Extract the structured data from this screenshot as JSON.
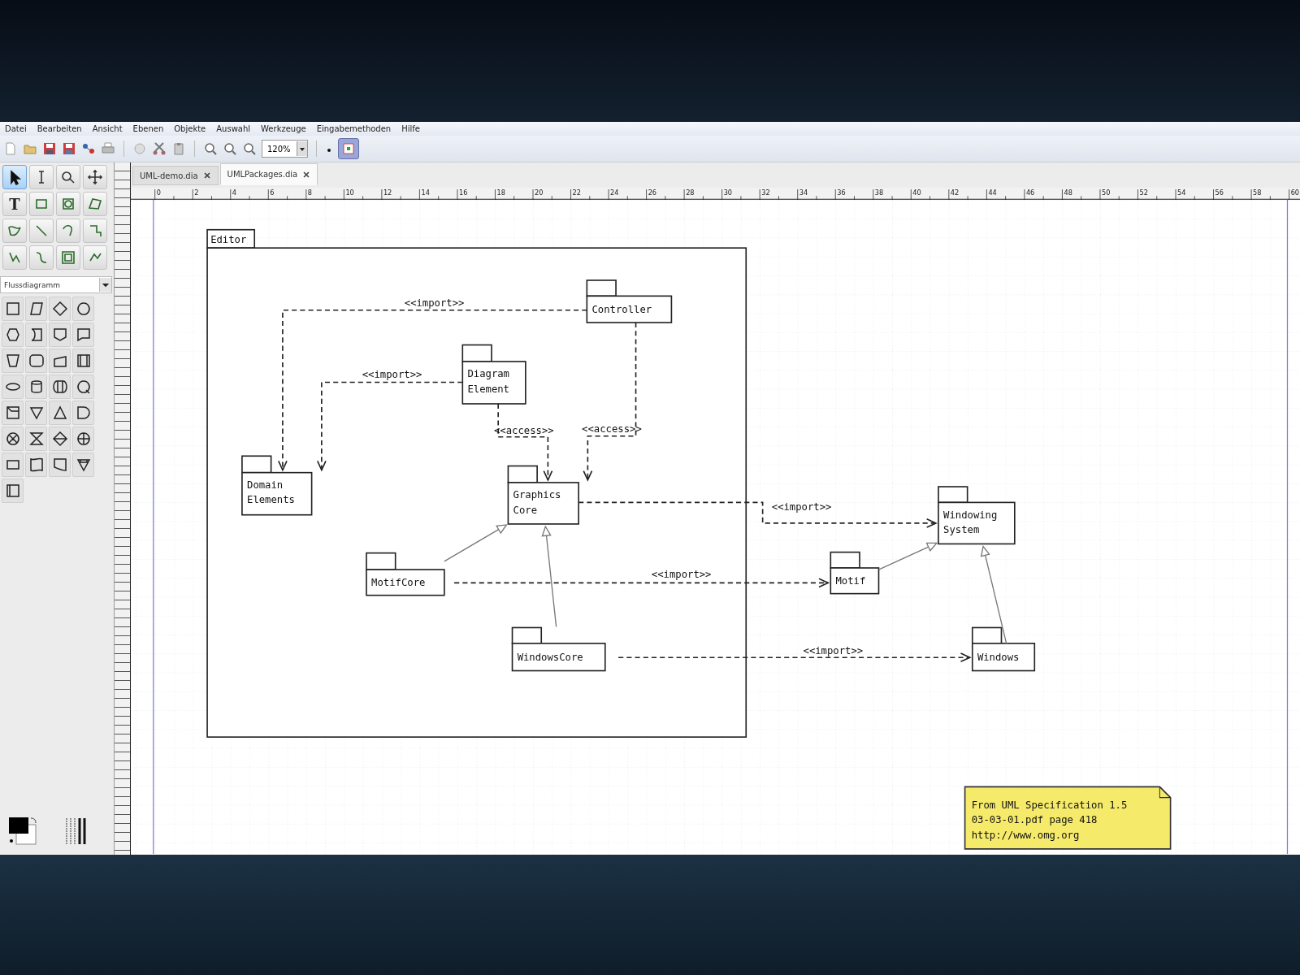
{
  "menu": [
    "Datei",
    "Bearbeiten",
    "Ansicht",
    "Ebenen",
    "Objekte",
    "Auswahl",
    "Werkzeuge",
    "Eingabemethoden",
    "Hilfe"
  ],
  "toolbar": {
    "zoom": "120%",
    "snap_toggle_on": true
  },
  "tabs": [
    {
      "label": "UML-demo.dia",
      "selected": false
    },
    {
      "label": "UMLPackages.dia",
      "selected": true
    }
  ],
  "toolbox": {
    "tools": [
      {
        "kind": "pointer",
        "selected": true
      },
      {
        "kind": "text-cursor",
        "selected": false
      },
      {
        "kind": "magnifier",
        "selected": false
      },
      {
        "kind": "move",
        "selected": false
      },
      {
        "kind": "text",
        "glyph": "T",
        "selected": false
      },
      {
        "kind": "box",
        "selected": false
      },
      {
        "kind": "ellipse",
        "selected": false
      },
      {
        "kind": "polygon",
        "selected": false
      },
      {
        "kind": "beziergon",
        "selected": false
      },
      {
        "kind": "line",
        "selected": false
      },
      {
        "kind": "arc",
        "selected": false
      },
      {
        "kind": "zigzag",
        "selected": false
      },
      {
        "kind": "polyline",
        "selected": false
      },
      {
        "kind": "bezier",
        "selected": false
      },
      {
        "kind": "image",
        "selected": false
      },
      {
        "kind": "outline",
        "selected": false
      }
    ],
    "sheet": "Flussdiagramm"
  },
  "ruler": [
    "0",
    "2",
    "4",
    "6",
    "8",
    "10",
    "12",
    "14",
    "16",
    "18",
    "20",
    "22",
    "24",
    "26",
    "28",
    "30",
    "32",
    "34",
    "36",
    "38",
    "40",
    "42",
    "44",
    "46",
    "48",
    "50",
    "52",
    "54",
    "56",
    "58",
    "60"
  ],
  "diagram": {
    "container": "Editor",
    "packages": [
      {
        "lines": [
          "Controller"
        ]
      },
      {
        "lines": [
          "Diagram",
          "Element"
        ]
      },
      {
        "lines": [
          "Domain",
          "Elements"
        ]
      },
      {
        "lines": [
          "Graphics",
          "Core"
        ]
      },
      {
        "lines": [
          "Windowing",
          "System"
        ]
      },
      {
        "lines": [
          "MotifCore"
        ]
      },
      {
        "lines": [
          "Motif"
        ]
      },
      {
        "lines": [
          "WindowsCore"
        ]
      },
      {
        "lines": [
          "Windows"
        ]
      }
    ],
    "dependencies": [
      {
        "label": "<<import>>"
      },
      {
        "label": "<<import>>"
      },
      {
        "label": "<<access>>"
      },
      {
        "label": "<<access>>"
      },
      {
        "label": "<<import>>"
      },
      {
        "label": "<<import>>"
      },
      {
        "label": "<<import>>"
      }
    ],
    "note": [
      "From UML Specification 1.5",
      "03-03-01.pdf page 418",
      "http://www.omg.org"
    ]
  }
}
